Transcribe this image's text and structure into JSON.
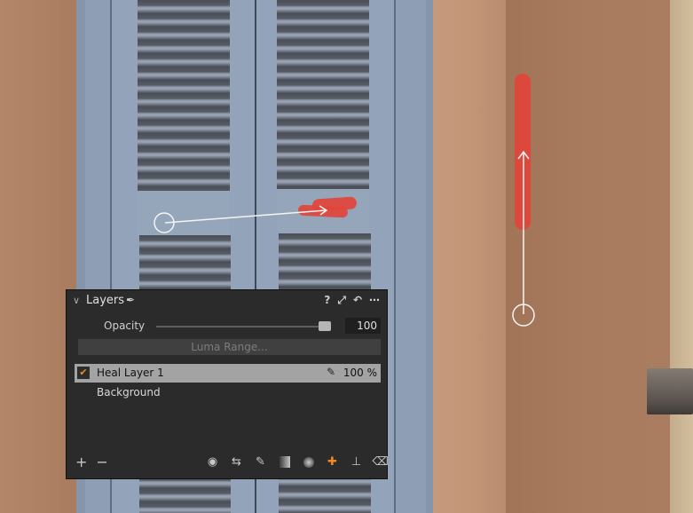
{
  "panel": {
    "title": "Layers",
    "header_icons": {
      "help": "?",
      "expand": "⤢",
      "reset": "↶",
      "more": "⋯"
    },
    "opacity_label": "Opacity",
    "opacity_value": "100",
    "opacity_fraction": 1.0,
    "luma_range_label": "Luma Range...",
    "layers": [
      {
        "name": "Heal Layer 1",
        "checked": true,
        "selected": true,
        "kind_icon": "bandage-icon",
        "opacity": "100 %"
      },
      {
        "name": "Background",
        "checked": false,
        "selected": false
      }
    ],
    "footer": {
      "add": "+",
      "remove": "−",
      "tools": [
        {
          "name": "view-mask",
          "glyph": "◉"
        },
        {
          "name": "adjustments",
          "glyph": "⇆"
        },
        {
          "name": "brush",
          "glyph": "✎"
        },
        {
          "name": "linear-gradient",
          "glyph": ""
        },
        {
          "name": "radial-gradient",
          "glyph": ""
        },
        {
          "name": "heal",
          "glyph": "✚",
          "active": true
        },
        {
          "name": "clone-stamp",
          "glyph": "⊥"
        },
        {
          "name": "eraser",
          "glyph": "⌫"
        }
      ]
    }
  },
  "colors": {
    "accent": "#f18a1d",
    "heal_mask": "#e1453a",
    "panel_bg": "#2b2b2b",
    "selected_row": "#a3a3a3"
  }
}
